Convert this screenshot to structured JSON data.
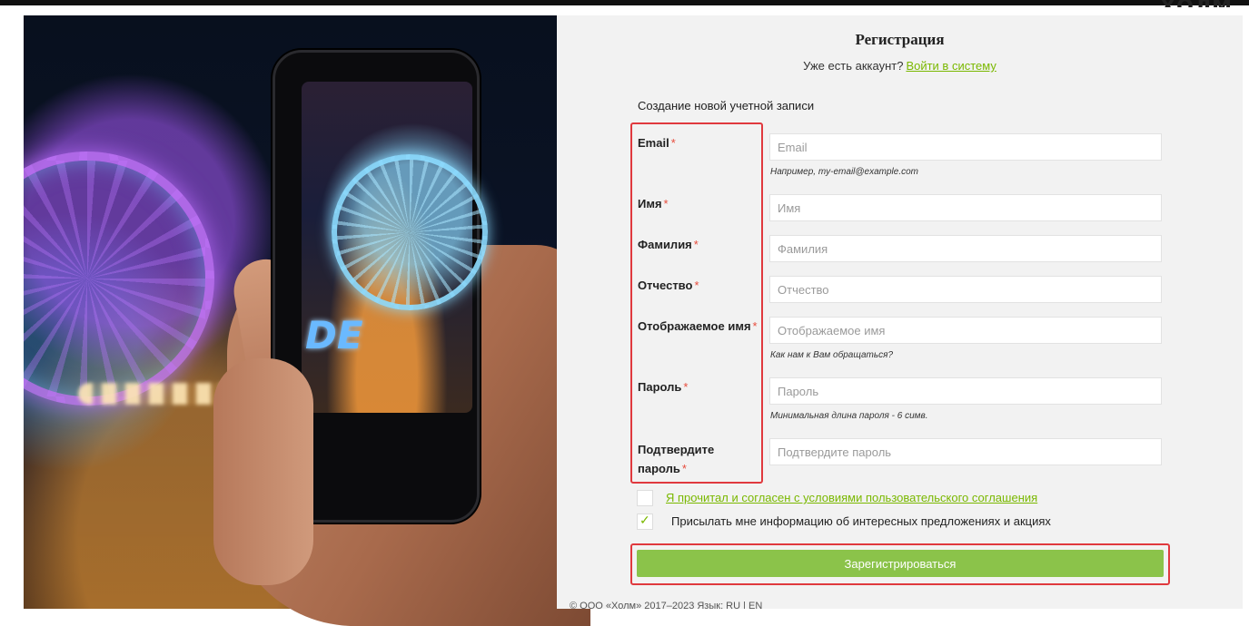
{
  "header": {
    "logo_text": "ХОЛМ"
  },
  "form": {
    "title": "Регистрация",
    "has_account_text": "Уже есть аккаунт?",
    "login_link": "Войти в систему",
    "section_title": "Создание новой учетной записи",
    "required_mark": "*",
    "fields": [
      {
        "label": "Email",
        "placeholder": "Email",
        "hint": "Например, my-email@example.com"
      },
      {
        "label": "Имя",
        "placeholder": "Имя"
      },
      {
        "label": "Фамилия",
        "placeholder": "Фамилия"
      },
      {
        "label": "Отчество",
        "placeholder": "Отчество"
      },
      {
        "label": "Отображаемое имя",
        "placeholder": "Отображаемое имя",
        "hint": "Как нам к Вам обращаться?"
      },
      {
        "label": "Пароль",
        "placeholder": "Пароль",
        "hint": "Минимальная длина пароля - 6 симв."
      },
      {
        "label_line1": "Подтвердите",
        "label_line2": "пароль",
        "placeholder": "Подтвердите пароль"
      }
    ],
    "checkboxes": [
      {
        "label": "Я прочитал и согласен с условиями пользовательского соглашения",
        "checked": false
      },
      {
        "label": "Присылать мне информацию об интересных предложениях и акциях",
        "checked": true
      }
    ],
    "submit_label": "Зарегистрироваться"
  },
  "footer": {
    "text": "© ООО «Холм» 2017–2023 Язык: RU | EN"
  },
  "colors": {
    "accent": "#8bc34a",
    "link": "#7ab800",
    "required": "#e74c3c",
    "highlight": "#e0393e",
    "panel": "#f2f2f2"
  }
}
